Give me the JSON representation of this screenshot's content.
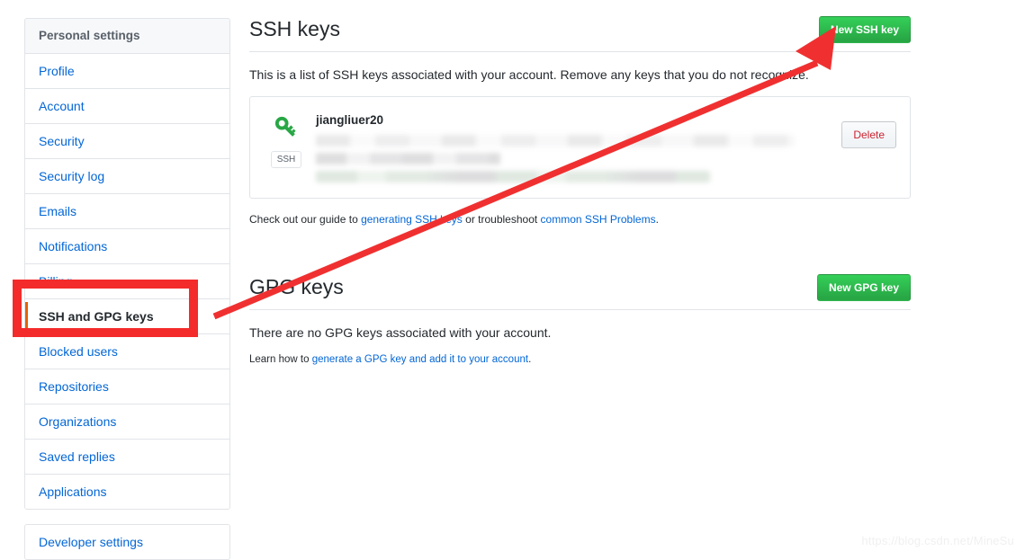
{
  "sidebar": {
    "header": "Personal settings",
    "items": [
      {
        "label": "Profile",
        "selected": false
      },
      {
        "label": "Account",
        "selected": false
      },
      {
        "label": "Security",
        "selected": false
      },
      {
        "label": "Security log",
        "selected": false
      },
      {
        "label": "Emails",
        "selected": false
      },
      {
        "label": "Notifications",
        "selected": false
      },
      {
        "label": "Billing",
        "selected": false
      },
      {
        "label": "SSH and GPG keys",
        "selected": true
      },
      {
        "label": "Blocked users",
        "selected": false
      },
      {
        "label": "Repositories",
        "selected": false
      },
      {
        "label": "Organizations",
        "selected": false
      },
      {
        "label": "Saved replies",
        "selected": false
      },
      {
        "label": "Applications",
        "selected": false
      }
    ],
    "developer_settings": "Developer settings"
  },
  "ssh_section": {
    "title": "SSH keys",
    "new_key_button": "New SSH key",
    "description": "This is a list of SSH keys associated with your account. Remove any keys that you do not recognize.",
    "key": {
      "icon": "key-icon",
      "badge": "SSH",
      "title": "jiangliuer20",
      "fingerprint_redacted": true,
      "delete_button": "Delete"
    },
    "help": {
      "prefix": "Check out our guide to ",
      "link1": "generating SSH keys",
      "middle": " or troubleshoot ",
      "link2": "common SSH Problems",
      "suffix": "."
    }
  },
  "gpg_section": {
    "title": "GPG keys",
    "new_key_button": "New GPG key",
    "empty_message": "There are no GPG keys associated with your account.",
    "help": {
      "prefix": "Learn how to ",
      "link1": "generate a GPG key and add it to your account",
      "suffix": "."
    }
  },
  "annotations": {
    "highlight_box_target": "SSH and GPG keys",
    "arrow_color": "#f03030",
    "box_color": "#f42b2b",
    "arrow_points_to": "New SSH key"
  },
  "watermark": "https://blog.csdn.net/MineSu",
  "colors": {
    "link": "#0366d6",
    "green_button": "#2cbe4e",
    "delete_text": "#cb2431",
    "selected_accent": "#e36209",
    "border": "#e1e4e8",
    "header_bg": "#f6f8fa"
  }
}
